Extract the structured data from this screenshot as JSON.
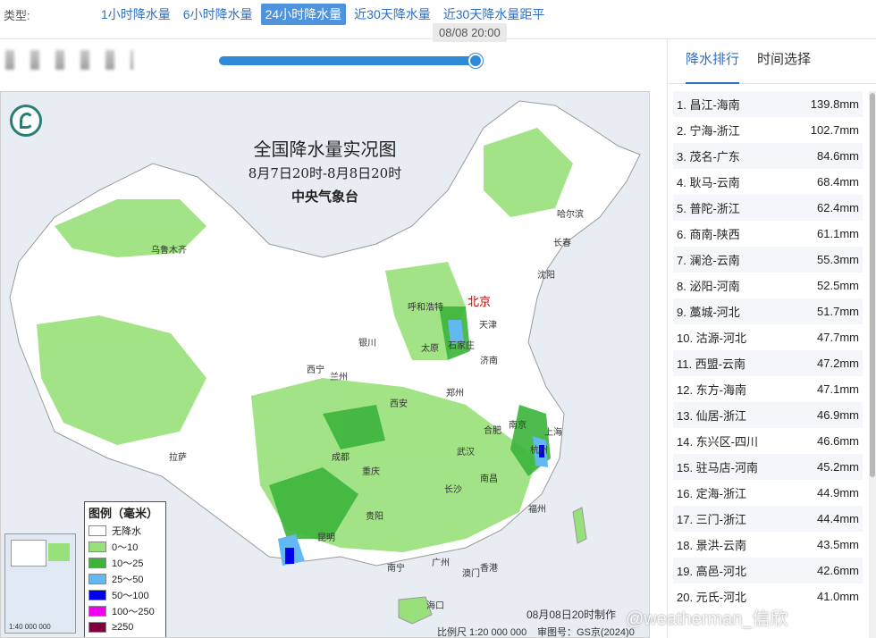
{
  "topbar": {
    "type_label": "类型:",
    "tabs": [
      {
        "label": "1小时降水量"
      },
      {
        "label": "6小时降水量"
      },
      {
        "label": "24小时降水量"
      },
      {
        "label": "近30天降水量"
      },
      {
        "label": "近30天降水量距平"
      }
    ]
  },
  "timeline": {
    "tooltip": "08/08 20:00",
    "progress": 0.99
  },
  "map": {
    "title": "全国降水量实况图",
    "subtitle": "8月7日20时-8月8日20时",
    "issuer": "中央气象台",
    "capital": "北京",
    "cities": [
      "乌鲁木齐",
      "哈尔滨",
      "长春",
      "沈阳",
      "呼和浩特",
      "天津",
      "太原",
      "石家庄",
      "银川",
      "西宁",
      "兰州",
      "济南",
      "郑州",
      "西安",
      "合肥",
      "南京",
      "上海",
      "杭州",
      "成都",
      "重庆",
      "武汉",
      "拉萨",
      "南昌",
      "长沙",
      "福州",
      "昆明",
      "贵阳",
      "南宁",
      "广州",
      "澳门",
      "香港",
      "海口"
    ],
    "legend_title": "图例（毫米）",
    "legend": [
      {
        "label": "无降水",
        "color": "#ffffff"
      },
      {
        "label": "0～10",
        "color": "#98e07a"
      },
      {
        "label": "10～25",
        "color": "#3cb43c"
      },
      {
        "label": "25～50",
        "color": "#62b8f0"
      },
      {
        "label": "50～100",
        "color": "#0000f0"
      },
      {
        "label": "100～250",
        "color": "#f000f0"
      },
      {
        "label": "≥250",
        "color": "#80003c"
      }
    ],
    "scale_note": "比例尺  1:20 000 000",
    "review_no": "审图号：GS京(2024)0",
    "made_note": "08月08日20时制作",
    "inset_scale": "1:40 000 000"
  },
  "ranking": {
    "tabs": [
      {
        "label": "降水排行"
      },
      {
        "label": "时间选择"
      }
    ],
    "rows": [
      {
        "name": "1. 昌江-海南",
        "value": "139.8mm"
      },
      {
        "name": "2. 宁海-浙江",
        "value": "102.7mm"
      },
      {
        "name": "3. 茂名-广东",
        "value": "84.6mm"
      },
      {
        "name": "4. 耿马-云南",
        "value": "68.4mm"
      },
      {
        "name": "5. 普陀-浙江",
        "value": "62.4mm"
      },
      {
        "name": "6. 商南-陕西",
        "value": "61.1mm"
      },
      {
        "name": "7. 澜沧-云南",
        "value": "55.3mm"
      },
      {
        "name": "8. 泌阳-河南",
        "value": "52.5mm"
      },
      {
        "name": "9. 藁城-河北",
        "value": "51.7mm"
      },
      {
        "name": "10. 沽源-河北",
        "value": "47.7mm"
      },
      {
        "name": "11. 西盟-云南",
        "value": "47.2mm"
      },
      {
        "name": "12. 东方-海南",
        "value": "47.1mm"
      },
      {
        "name": "13. 仙居-浙江",
        "value": "46.9mm"
      },
      {
        "name": "14. 东兴区-四川",
        "value": "46.6mm"
      },
      {
        "name": "15. 驻马店-河南",
        "value": "45.2mm"
      },
      {
        "name": "16. 定海-浙江",
        "value": "44.9mm"
      },
      {
        "name": "17. 三门-浙江",
        "value": "44.4mm"
      },
      {
        "name": "18. 景洪-云南",
        "value": "43.5mm"
      },
      {
        "name": "19. 高邑-河北",
        "value": "42.6mm"
      },
      {
        "name": "20. 元氏-河北",
        "value": "41.0mm"
      }
    ]
  },
  "watermark": "@weatherman_信欣"
}
